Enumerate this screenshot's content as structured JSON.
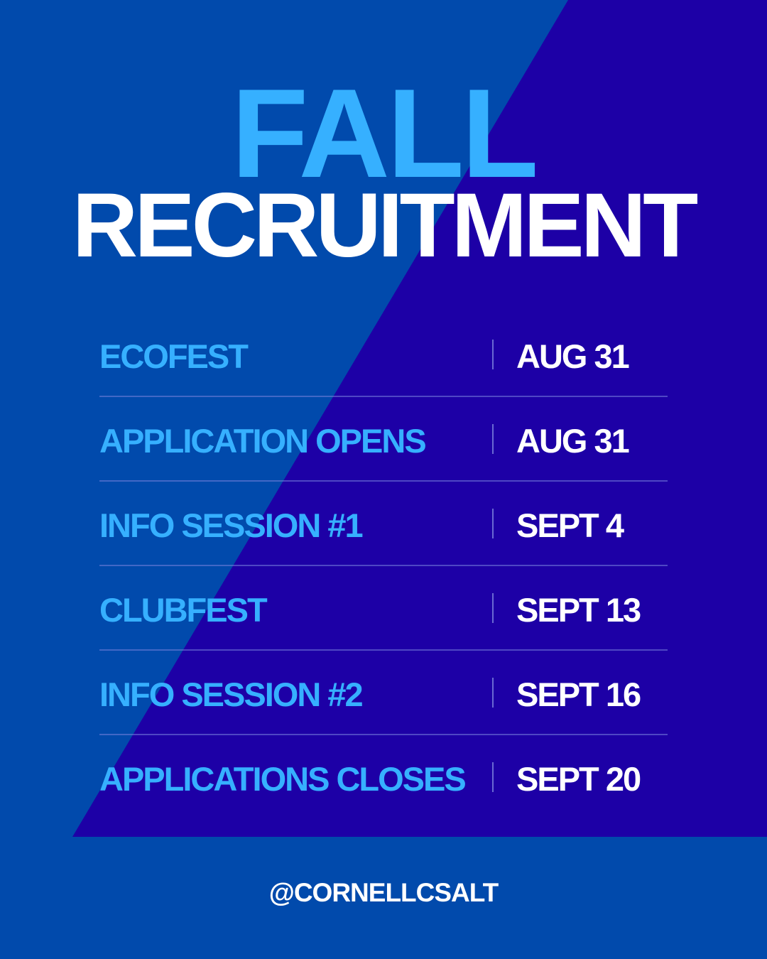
{
  "colors": {
    "background": "#014aac",
    "panel": "#1d00a6",
    "accent": "#36b0ff",
    "text": "#ffffff"
  },
  "title": {
    "line1": "FALL",
    "line2": "RECRUITMENT"
  },
  "schedule": [
    {
      "event": "ECOFEST",
      "date": "AUG 31"
    },
    {
      "event": "APPLICATION OPENS",
      "date": "AUG 31"
    },
    {
      "event": "INFO SESSION #1",
      "date": "SEPT 4"
    },
    {
      "event": "CLUBFEST",
      "date": "SEPT 13"
    },
    {
      "event": "INFO SESSION #2",
      "date": "SEPT 16"
    },
    {
      "event": "APPLICATIONS CLOSES",
      "date": "SEPT 20"
    }
  ],
  "footer": {
    "handle": "@CORNELLCSALT"
  }
}
